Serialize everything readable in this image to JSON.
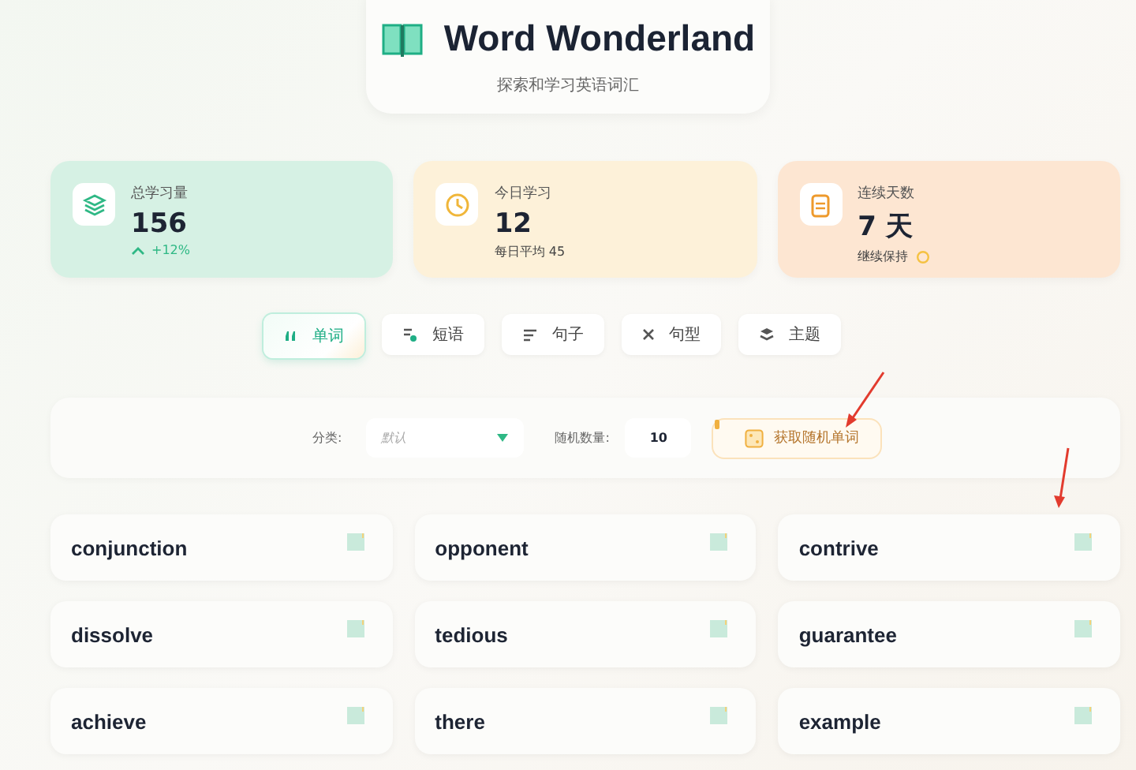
{
  "header": {
    "title": "Word Wonderland",
    "subtitle": "探索和学习英语词汇"
  },
  "stats": [
    {
      "kind": "trend",
      "label": "总学习量",
      "value": "156",
      "sub": "+12%",
      "color": "#d6f1e4"
    },
    {
      "kind": "text",
      "label": "今日学习",
      "value": "12",
      "sub": "每日平均 45",
      "color": "#fdf1d9"
    },
    {
      "kind": "streak",
      "label": "连续天数",
      "value": "7 天",
      "sub": "继续保持",
      "color": "#fde6d2"
    }
  ],
  "tabs": [
    {
      "label": "单词",
      "selected": true
    },
    {
      "label": "短语",
      "selected": false
    },
    {
      "label": "句子",
      "selected": false
    },
    {
      "label": "句型",
      "selected": false
    },
    {
      "label": "主题",
      "selected": false
    }
  ],
  "filter": {
    "category_label": "分类:",
    "category_placeholder": "默认",
    "count_label": "随机数量:",
    "count_value": "10",
    "button": "获取随机单词"
  },
  "words": [
    {
      "word": "conjunction"
    },
    {
      "word": "opponent"
    },
    {
      "word": "contrive"
    },
    {
      "word": "dissolve"
    },
    {
      "word": "tedious"
    },
    {
      "word": "guarantee"
    },
    {
      "word": "achieve"
    },
    {
      "word": "there"
    },
    {
      "word": "example"
    }
  ]
}
